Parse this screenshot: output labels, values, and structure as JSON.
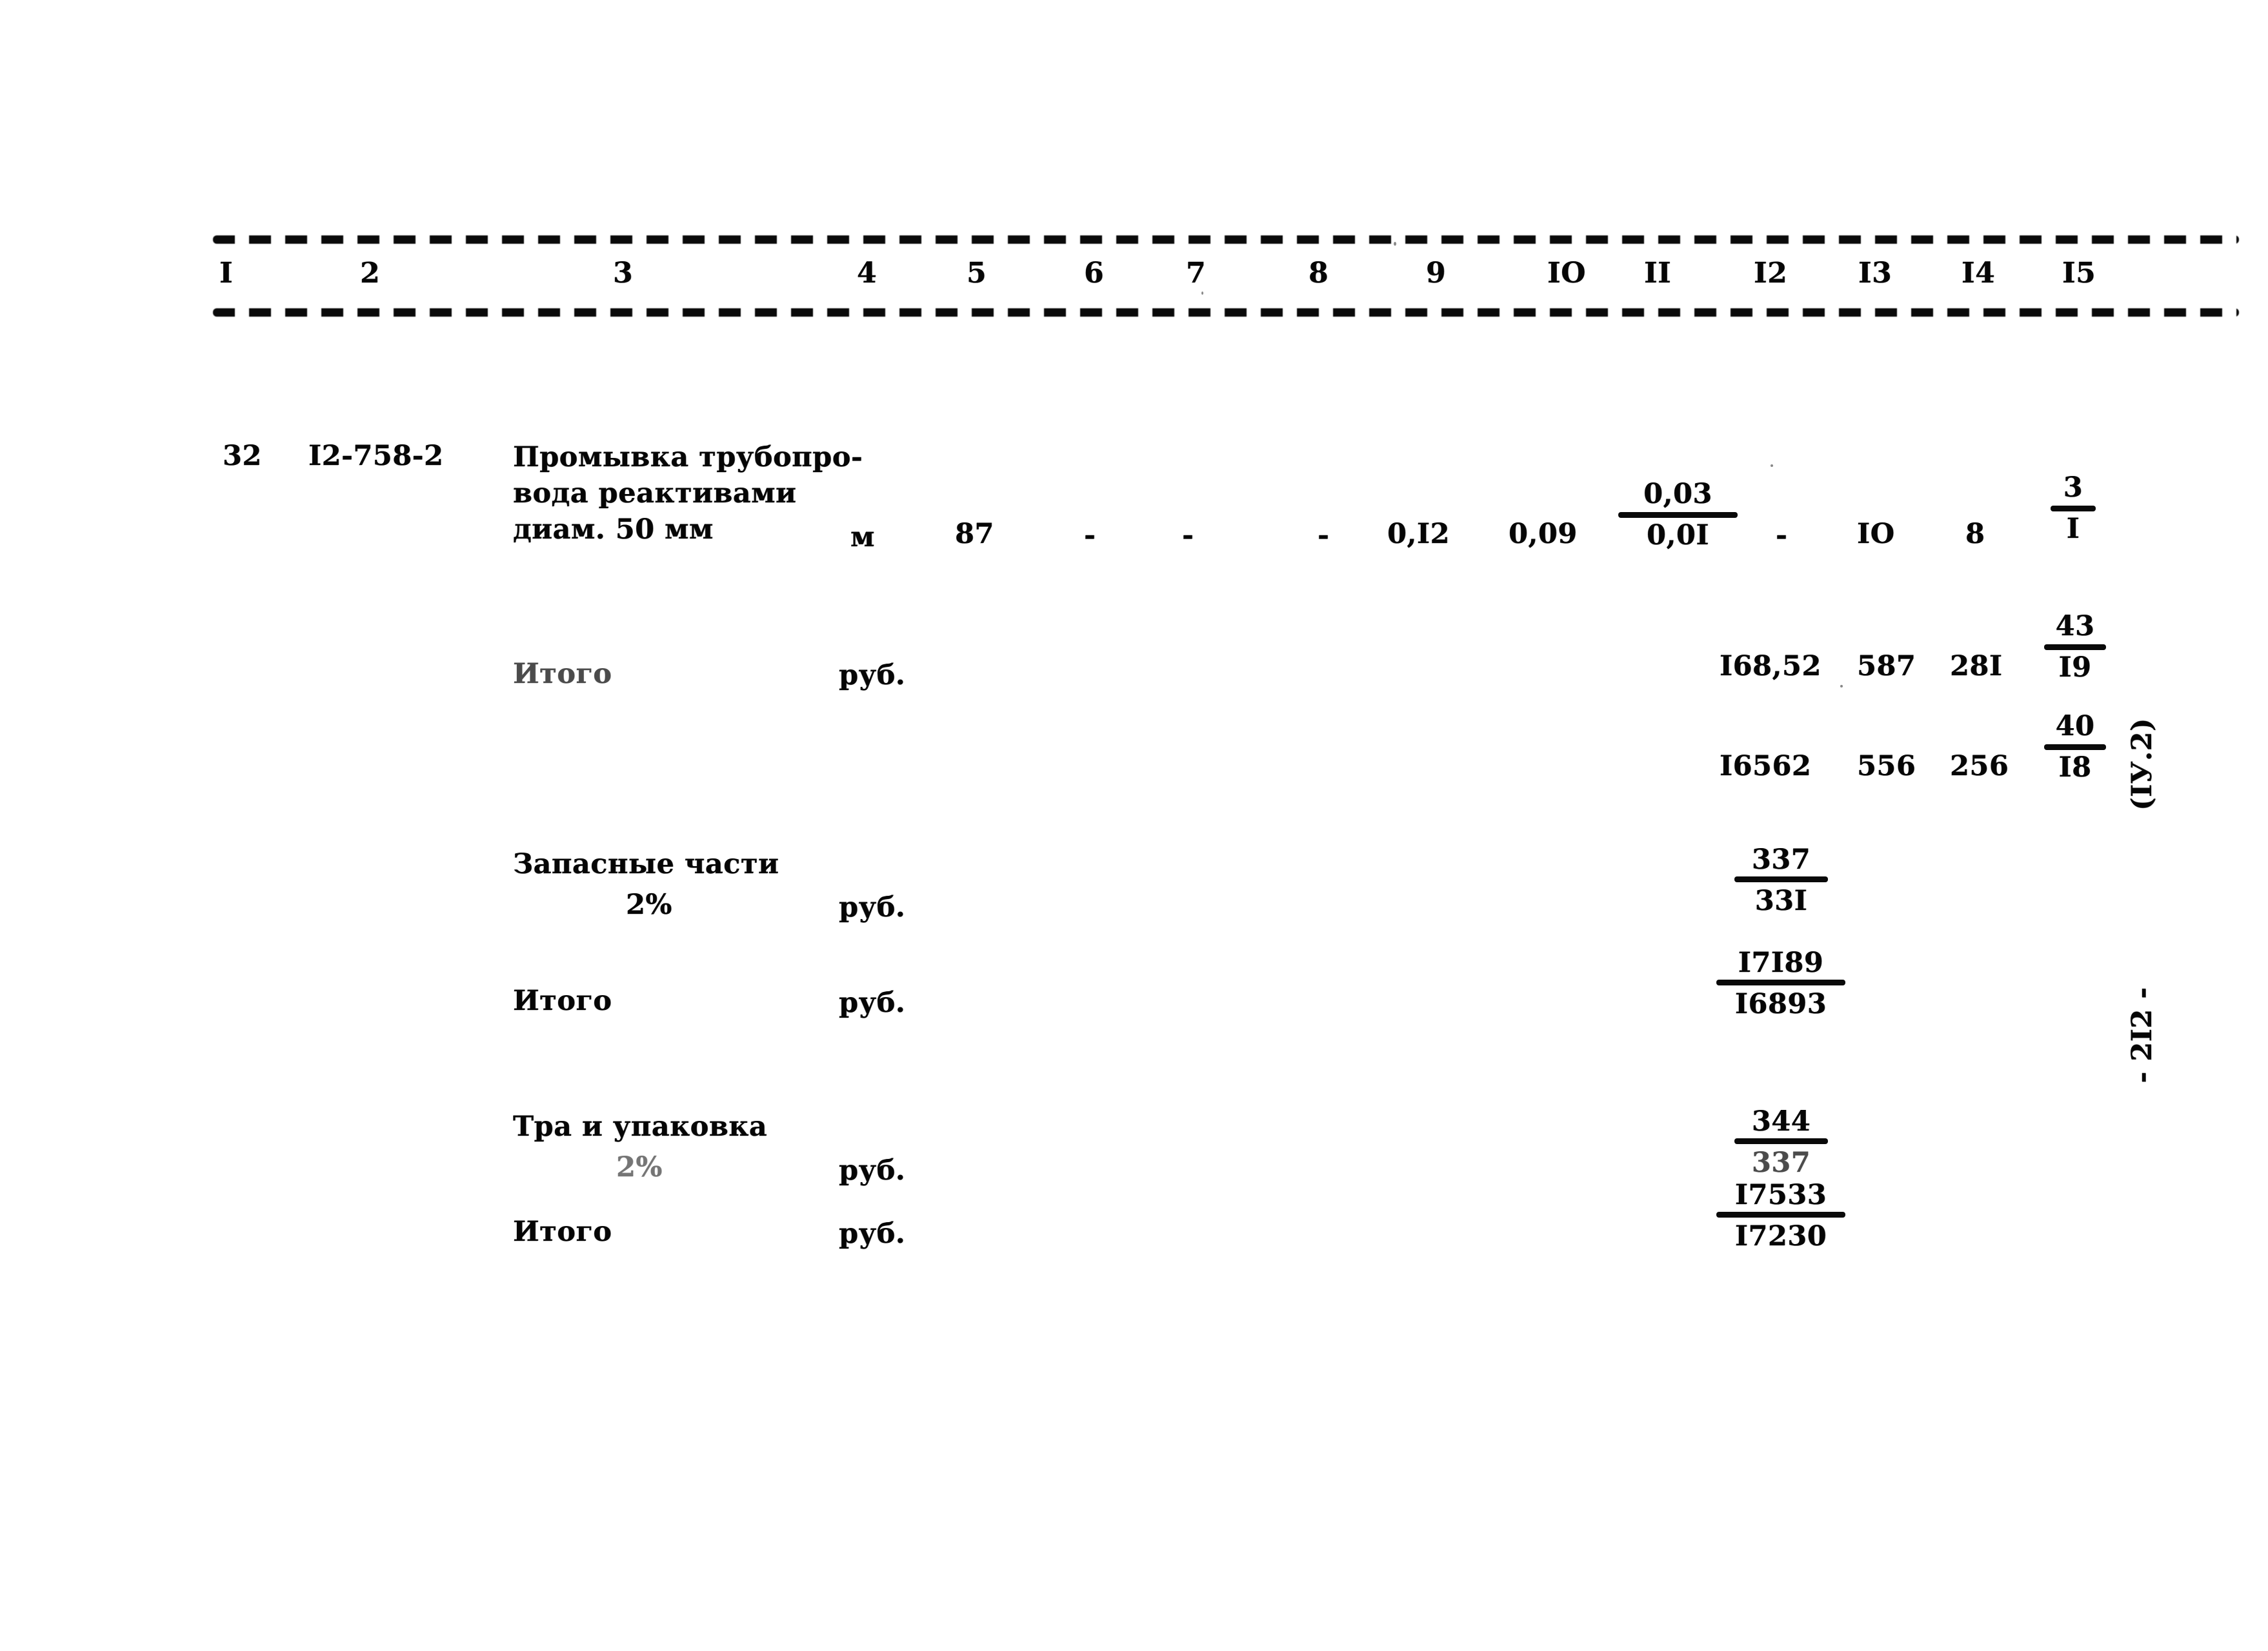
{
  "document": {
    "page_number_mark": "- 2I2 -",
    "section_mark": "(IУ.2)"
  },
  "table": {
    "column_numbers": [
      "I",
      "2",
      "3",
      "4",
      "5",
      "6",
      "7",
      "8",
      "9",
      "IO",
      "II",
      "I2",
      "I3",
      "I4",
      "I5"
    ],
    "rows": [
      {
        "kind": "item",
        "number": "32",
        "code": "I2-758-2",
        "description_lines": [
          "Промывка трубопро-",
          "вода реактивами",
          "диам. 50 мм"
        ],
        "unit": "м",
        "col4_qty": "87",
        "col5": "-",
        "col6": "-",
        "col7": "-",
        "col8": "0,I2",
        "col9": "0,09",
        "col10_fraction": {
          "numerator": "0,03",
          "denominator": "0,0I"
        },
        "col11": "-",
        "col12": "IO",
        "col13": "8",
        "col14_fraction": {
          "numerator": "3",
          "denominator": "I"
        }
      },
      {
        "kind": "total",
        "label": "Итого",
        "unit": "руб.",
        "line1": {
          "a": "I68,52",
          "b": "587",
          "c": "28I",
          "fraction": {
            "numerator": "43",
            "denominator": "I9"
          }
        },
        "line2": {
          "a": "I6562",
          "b": "556",
          "c": "256",
          "fraction": {
            "numerator": "40",
            "denominator": "I8"
          }
        }
      },
      {
        "kind": "subtotal",
        "label": "Запасные части",
        "percent": "2%",
        "unit": "руб.",
        "pair": {
          "top": "337",
          "bottom": "33I"
        }
      },
      {
        "kind": "total",
        "label": "Итого",
        "unit": "руб.",
        "pair": {
          "top": "I7I89",
          "bottom": "I6893"
        }
      },
      {
        "kind": "subtotal",
        "label": "Тра и упаковка",
        "percent": "2%",
        "unit": "руб.",
        "pair": {
          "top": "344",
          "bottom": "337"
        }
      },
      {
        "kind": "total",
        "label": "Итого",
        "unit": "руб.",
        "pair": {
          "top": "I7533",
          "bottom": "I7230"
        }
      }
    ]
  }
}
